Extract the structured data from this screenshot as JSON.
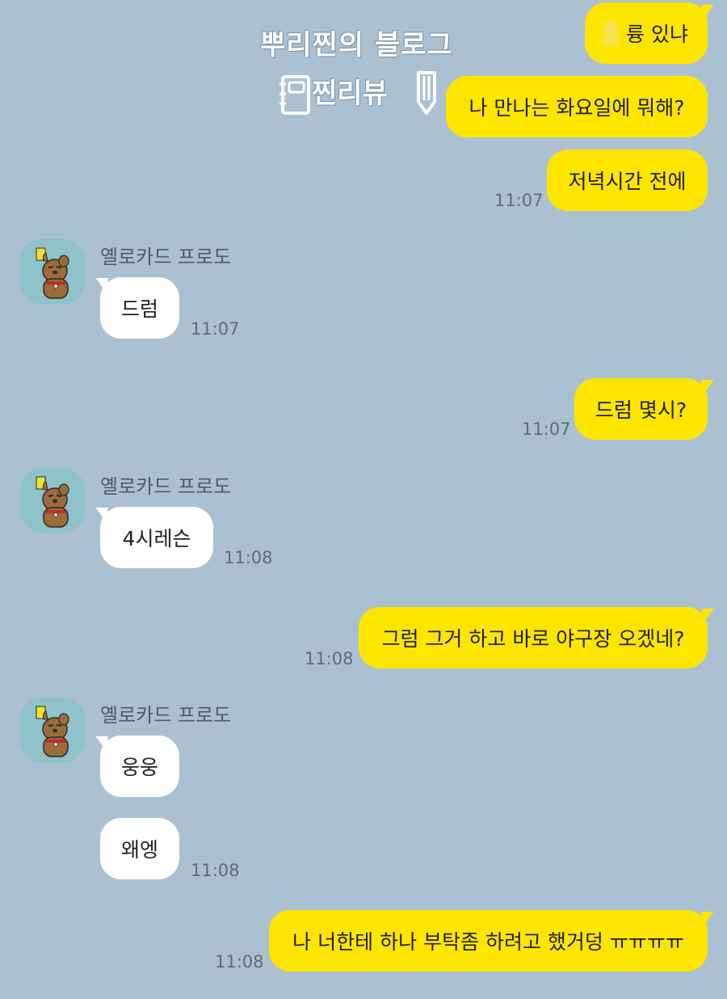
{
  "watermark": {
    "title": "뿌리찐의 블로그",
    "subtitle": "찐리뷰"
  },
  "colors": {
    "background": "#abc1d1",
    "my_bubble": "#fee500",
    "their_bubble": "#ffffff"
  },
  "messages": [
    {
      "from": "me",
      "text": "륭 있냐",
      "time": ""
    },
    {
      "from": "me",
      "text": "나 만나는 화요일에 뭐해?",
      "time": ""
    },
    {
      "from": "me",
      "text": "저녁시간 전에",
      "time": "11:07"
    },
    {
      "from": "them",
      "sender": "옐로카드 프로도",
      "text": "드럼",
      "time": "11:07"
    },
    {
      "from": "me",
      "text": "드럼 몇시?",
      "time": "11:07"
    },
    {
      "from": "them",
      "sender": "옐로카드 프로도",
      "text": "4시레슨",
      "time": "11:08"
    },
    {
      "from": "me",
      "text": "그럼 그거 하고 바로 야구장 오겠네?",
      "time": "11:08"
    },
    {
      "from": "them",
      "sender": "옐로카드 프로도",
      "text": "웅웅",
      "time": ""
    },
    {
      "from": "them",
      "text": "왜엥",
      "time": "11:08"
    },
    {
      "from": "me",
      "text": "나 너한테 하나 부탁좀 하려고 했거덩 ㅠㅠㅠㅠ",
      "time": "11:08"
    }
  ],
  "icons": {
    "avatar": "frodo-avatar-icon",
    "watermark_left": "notebook-icon",
    "watermark_right": "pencil-icon"
  }
}
